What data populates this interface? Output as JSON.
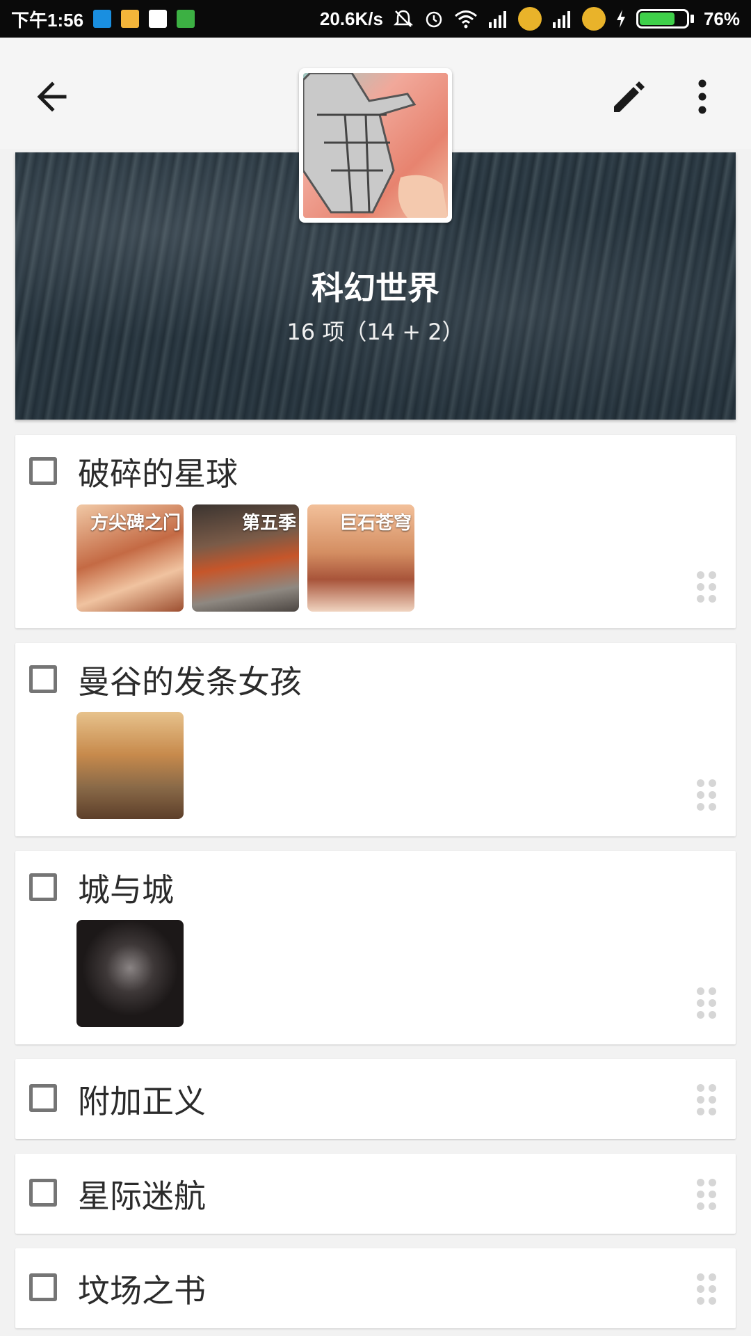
{
  "status_bar": {
    "time": "下午1:56",
    "network_speed": "20.6K/s",
    "battery": "76%",
    "battery_level": 0.76
  },
  "app_bar": {
    "back_icon": "arrow-left-icon",
    "edit_icon": "pencil-icon",
    "more_icon": "more-vertical-icon"
  },
  "collection": {
    "title": "科幻世界",
    "count": "16 项（14 + 2）"
  },
  "items": [
    {
      "title": "破碎的星球",
      "books": [
        {
          "label": "方尖碑之门",
          "colors": [
            "#e9a47d",
            "#b45b3a",
            "#f0c6a0"
          ]
        },
        {
          "label": "第五季",
          "colors": [
            "#4e4540",
            "#c65a28",
            "#8f8a84"
          ]
        },
        {
          "label": "巨石苍穹",
          "colors": [
            "#f0b48e",
            "#b8683e",
            "#f6d6bd"
          ]
        }
      ]
    },
    {
      "title": "曼谷的发条女孩",
      "books": [
        {
          "label": "",
          "colors": [
            "#d9a56a",
            "#7a5a3a",
            "#c9823e"
          ]
        }
      ]
    },
    {
      "title": "城与城",
      "books": [
        {
          "label": "",
          "colors": [
            "#1f1a1a",
            "#3a3333",
            "#6b6464"
          ]
        }
      ]
    },
    {
      "title": "附加正义",
      "books": []
    },
    {
      "title": "星际迷航",
      "books": []
    },
    {
      "title": "坟场之书",
      "books": []
    }
  ]
}
